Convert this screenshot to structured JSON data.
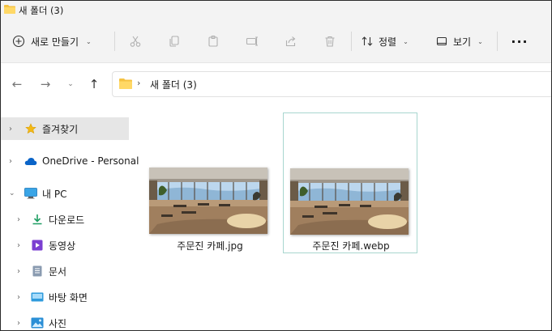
{
  "window": {
    "title": "새 폴더 (3)"
  },
  "commandbar": {
    "new_label": "새로 만들기",
    "sort_label": "정렬",
    "view_label": "보기",
    "more_label": "···"
  },
  "address": {
    "path": "새 폴더 (3)"
  },
  "sidebar": {
    "items": [
      {
        "label": "즐겨찾기",
        "icon": "star-icon"
      },
      {
        "label": "OneDrive - Personal",
        "icon": "onedrive-cloud-icon"
      },
      {
        "label": "내 PC",
        "icon": "pc-monitor-icon"
      },
      {
        "label": "다운로드",
        "icon": "download-icon"
      },
      {
        "label": "동영상",
        "icon": "video-icon"
      },
      {
        "label": "문서",
        "icon": "document-icon"
      },
      {
        "label": "바탕 화면",
        "icon": "desktop-icon"
      },
      {
        "label": "사진",
        "icon": "pictures-icon"
      }
    ]
  },
  "files": [
    {
      "name": "주문진 카페.jpg"
    },
    {
      "name": "주문진 카페.webp"
    }
  ],
  "colors": {
    "folder": "#f5c242",
    "accent": "#0067c0",
    "selected_bg": "#e6e6e6",
    "focus_border": "#a8d6cf"
  }
}
